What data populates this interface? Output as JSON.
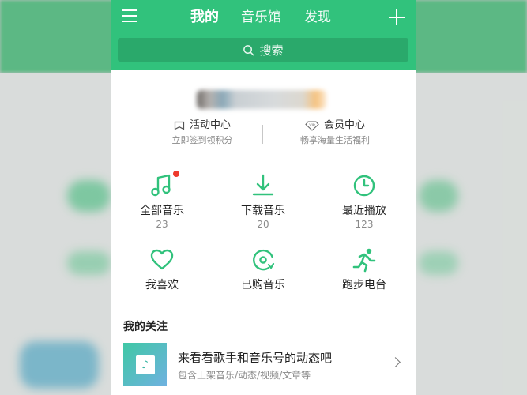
{
  "header": {
    "tabs": [
      {
        "label": "我的",
        "active": true
      },
      {
        "label": "音乐馆",
        "active": false
      },
      {
        "label": "发现",
        "active": false
      }
    ]
  },
  "search": {
    "placeholder": "搜索"
  },
  "activities": {
    "left": {
      "title": "活动中心",
      "subtitle": "立即签到领积分"
    },
    "right": {
      "title": "会员中心",
      "subtitle": "畅享海量生活福利",
      "badge": "VIP"
    }
  },
  "grid": [
    {
      "label": "全部音乐",
      "count": "23",
      "icon": "music-note-icon"
    },
    {
      "label": "下载音乐",
      "count": "20",
      "icon": "download-icon"
    },
    {
      "label": "最近播放",
      "count": "123",
      "icon": "clock-icon"
    },
    {
      "label": "我喜欢",
      "icon": "heart-icon"
    },
    {
      "label": "已购音乐",
      "icon": "purchased-disc-icon"
    },
    {
      "label": "跑步电台",
      "icon": "running-icon"
    }
  ],
  "follow_section": {
    "title": "我的关注",
    "item": {
      "title": "来看看歌手和音乐号的动态吧",
      "subtitle": "包含上架音乐/动态/视频/文章等"
    }
  },
  "colors": {
    "accent": "#31c27c",
    "search_bg": "#2aa96b",
    "badge_dot": "#ee3a2c"
  }
}
